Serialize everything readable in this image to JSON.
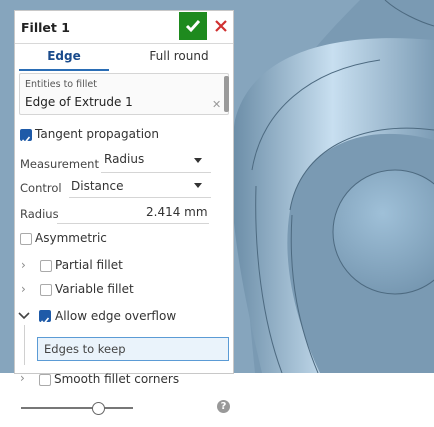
{
  "dialog": {
    "title": "Fillet 1",
    "tabs": [
      "Edge",
      "Full round"
    ],
    "active_tab": "Edge",
    "entities": {
      "label": "Entities to fillet",
      "value": "Edge of Extrude 1"
    },
    "tangent_propagation": {
      "label": "Tangent propagation",
      "checked": true
    },
    "measurement": {
      "label": "Measurement",
      "value": "Radius"
    },
    "control": {
      "label": "Control",
      "value": "Distance"
    },
    "radius": {
      "label": "Radius",
      "value": "2.414 mm"
    },
    "asymmetric": {
      "label": "Asymmetric",
      "checked": false
    },
    "partial_fillet": {
      "label": "Partial fillet",
      "checked": false
    },
    "variable_fillet": {
      "label": "Variable fillet",
      "checked": false
    },
    "allow_edge_overflow": {
      "label": "Allow edge overflow",
      "checked": true
    },
    "edges_to_keep": {
      "placeholder": "Edges to keep"
    },
    "smooth_fillet_corners": {
      "label": "Smooth fillet corners",
      "checked": false
    },
    "help_glyph": "?"
  },
  "colors": {
    "accent": "#1e5aa8",
    "ok": "#1e8a1e",
    "cancel": "#d03030",
    "viewport": "#7f9fb8"
  },
  "icons": [
    "check-icon",
    "close-icon",
    "clear-icon",
    "chevron-right-icon",
    "chevron-down-icon",
    "help-icon"
  ]
}
